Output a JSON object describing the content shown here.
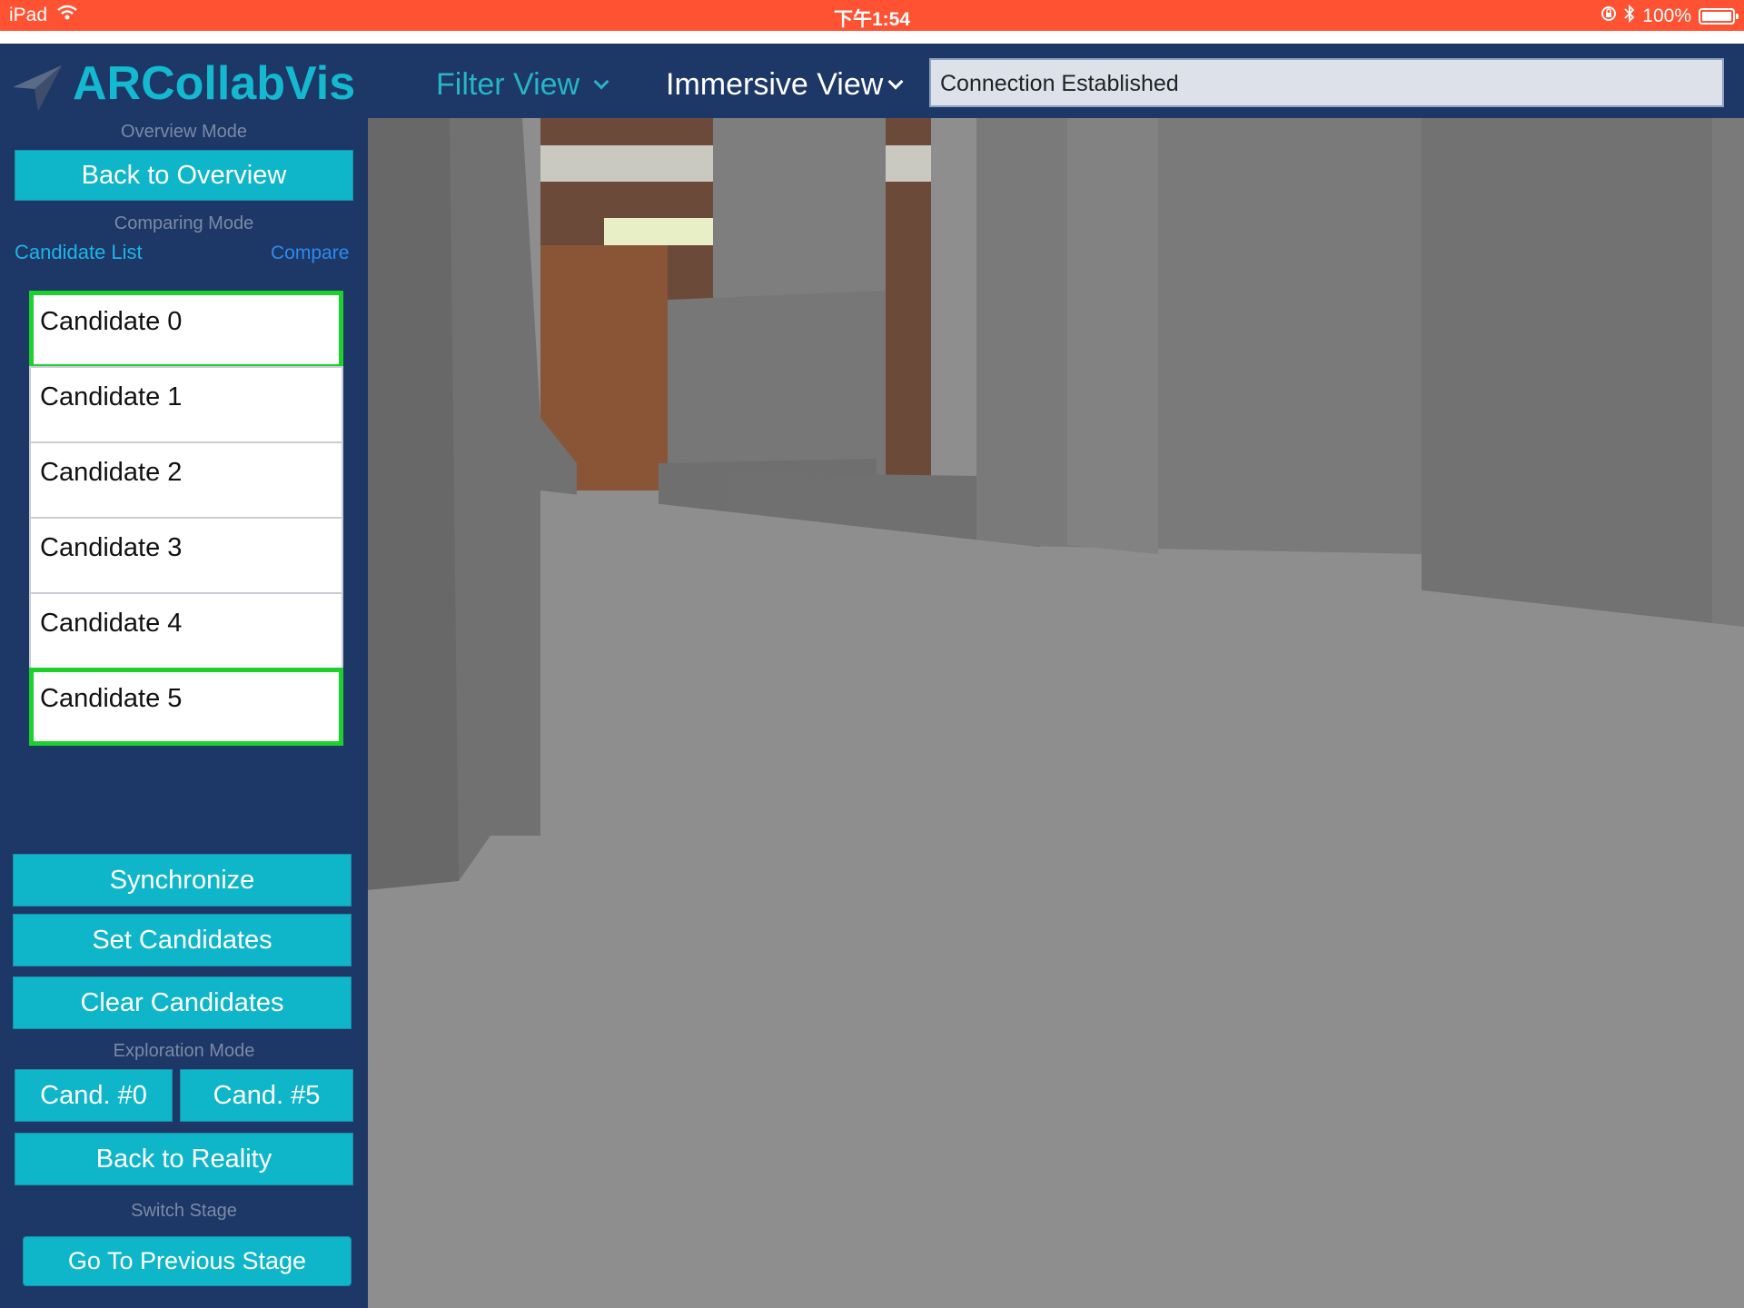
{
  "status_bar": {
    "device": "iPad",
    "time": "下午1:54",
    "battery": "100%"
  },
  "header": {
    "app_title": "ARCollabVis",
    "filter_view": "Filter View",
    "immersive_view": "Immersive View",
    "connection_status": "Connection Established"
  },
  "sidebar": {
    "overview_mode_label": "Overview Mode",
    "back_to_overview": "Back to Overview",
    "comparing_mode_label": "Comparing Mode",
    "candidate_list_label": "Candidate List",
    "compare_link": "Compare",
    "candidates": [
      {
        "label": "Candidate 0",
        "selected": true
      },
      {
        "label": "Candidate 1",
        "selected": false
      },
      {
        "label": "Candidate 2",
        "selected": false
      },
      {
        "label": "Candidate 3",
        "selected": false
      },
      {
        "label": "Candidate 4",
        "selected": false
      },
      {
        "label": "Candidate 5",
        "selected": true
      }
    ],
    "synchronize": "Synchronize",
    "set_candidates": "Set Candidates",
    "clear_candidates": "Clear Candidates",
    "exploration_mode_label": "Exploration Mode",
    "cand_0": "Cand. #0",
    "cand_5": "Cand. #5",
    "back_to_reality": "Back to Reality",
    "switch_stage_label": "Switch Stage",
    "go_to_previous_stage": "Go To Previous Stage"
  },
  "colors": {
    "status_bar": "#ff5233",
    "sidebar_bg": "#1d3766",
    "accent_button": "#0fb6c9",
    "selection_border": "#1cd12c",
    "scene_floor": "#8e8e8e"
  },
  "icons": {
    "logo": "navigation-arrow-icon",
    "wifi": "wifi-icon",
    "bluetooth": "bluetooth-icon",
    "lock_rotation": "orientation-lock-icon",
    "battery": "battery-icon"
  }
}
